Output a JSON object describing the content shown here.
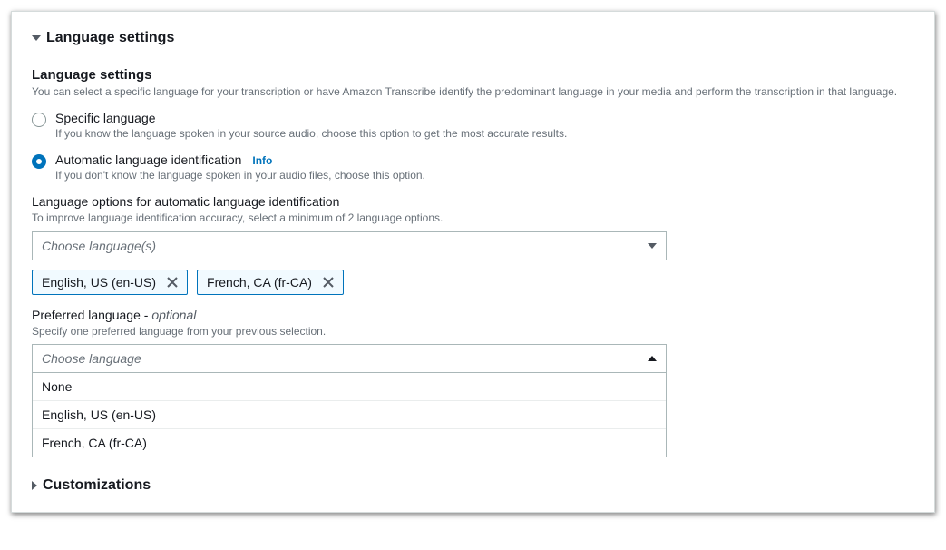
{
  "section_language": {
    "title": "Language settings",
    "subheading": "Language settings",
    "description": "You can select a specific language for your transcription or have Amazon Transcribe identify the predominant language in your media and perform the transcription in that language.",
    "radios": {
      "specific": {
        "label": "Specific language",
        "desc": "If you know the language spoken in your source audio, choose this option to get the most accurate results."
      },
      "automatic": {
        "label": "Automatic language identification",
        "info": "Info",
        "desc": "If you don't know the language spoken in your audio files, choose this option."
      }
    },
    "lang_options": {
      "label": "Language options for automatic language identification",
      "desc": "To improve language identification accuracy, select a minimum of 2 language options.",
      "placeholder": "Choose language(s)",
      "tokens": [
        "English, US (en-US)",
        "French, CA (fr-CA)"
      ]
    },
    "preferred": {
      "label_prefix": "Preferred language - ",
      "label_optional": "optional",
      "desc": "Specify one preferred language from your previous selection.",
      "placeholder": "Choose language",
      "options": [
        "None",
        "English, US (en-US)",
        "French, CA (fr-CA)"
      ]
    }
  },
  "section_customizations": {
    "title": "Customizations"
  }
}
